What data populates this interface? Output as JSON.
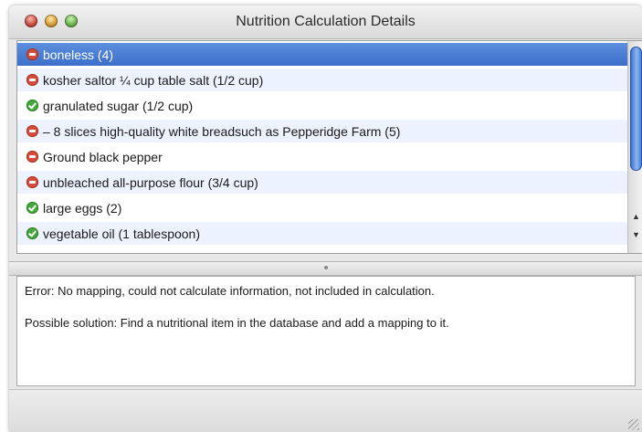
{
  "window": {
    "title": "Nutrition Calculation Details"
  },
  "ingredients": [
    {
      "label": "boneless (4)",
      "status": "error",
      "selected": true
    },
    {
      "label": "kosher saltor ¼ cup table salt (1/2 cup)",
      "status": "error",
      "selected": false
    },
    {
      "label": "granulated sugar (1/2 cup)",
      "status": "ok",
      "selected": false
    },
    {
      "label": "– 8 slices high-quality white breadsuch as Pepperidge Farm (5)",
      "status": "error",
      "selected": false
    },
    {
      "label": "Ground black pepper",
      "status": "error",
      "selected": false
    },
    {
      "label": "unbleached all-purpose flour (3/4 cup)",
      "status": "error",
      "selected": false
    },
    {
      "label": "large eggs (2)",
      "status": "ok",
      "selected": false
    },
    {
      "label": "vegetable oil (1 tablespoon)",
      "status": "ok",
      "selected": false
    }
  ],
  "details": {
    "error_text": "Error: No mapping, could not calculate information, not included in calculation.",
    "solution_text": "Possible solution: Find a nutritional item in the database and add a mapping to it."
  },
  "colors": {
    "selection": "#3b6fcb",
    "error_icon": "#d44b3b",
    "ok_icon": "#44a83a",
    "alt_row": "#edf3fe"
  }
}
